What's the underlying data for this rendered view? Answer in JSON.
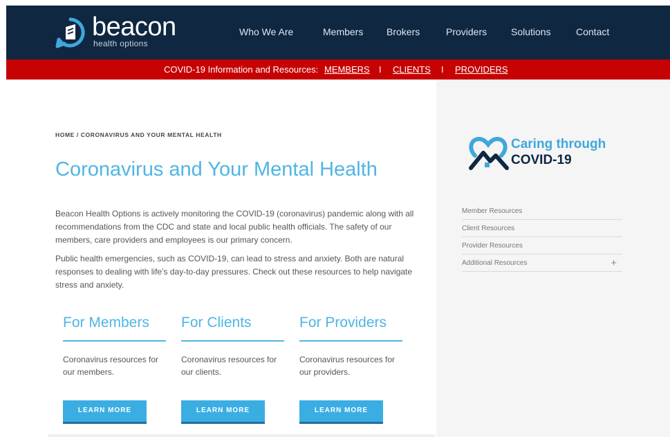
{
  "header": {
    "logo_word": "beacon",
    "logo_sub": "health options",
    "nav": [
      "Who We Are",
      "Members",
      "Brokers",
      "Providers",
      "Solutions",
      "Contact"
    ]
  },
  "covid_bar": {
    "label": "COVID-19 Information and Resources:",
    "links": [
      "MEMBERS",
      "CLIENTS",
      "PROVIDERS"
    ],
    "separator": "I"
  },
  "main": {
    "breadcrumb": "HOME / CORONAVIRUS AND YOUR MENTAL HEALTH",
    "title": "Coronavirus and Your Mental Health",
    "paragraphs": [
      "Beacon Health Options is actively monitoring the COVID-19 (coronavirus) pandemic along with all recommendations from the CDC and state and local public health officials. The safety of our members, care providers and employees is our primary concern.",
      "Public health emergencies, such as COVID-19, can lead to stress and anxiety. Both are natural responses to dealing with life’s day-to-day pressures. Check out these resources to help navigate stress and anxiety."
    ],
    "cards": [
      {
        "title": "For Members",
        "text": "Coronavirus resources for our members.",
        "button": "LEARN MORE"
      },
      {
        "title": "For Clients",
        "text": "Coronavirus resources for our clients.",
        "button": "LEARN MORE"
      },
      {
        "title": "For Providers",
        "text": "Coronavirus resources for our providers.",
        "button": "LEARN MORE"
      }
    ]
  },
  "sidebar": {
    "badge_line1": "Caring through",
    "badge_line2": "COVID-19",
    "links": [
      "Member Resources",
      "Client Resources",
      "Provider Resources",
      "Additional Resources"
    ],
    "expand_symbol": "+"
  },
  "colors": {
    "navy": "#0f2741",
    "red": "#c70202",
    "accent_blue": "#4fb5e4",
    "button_blue": "#3aaee3"
  }
}
